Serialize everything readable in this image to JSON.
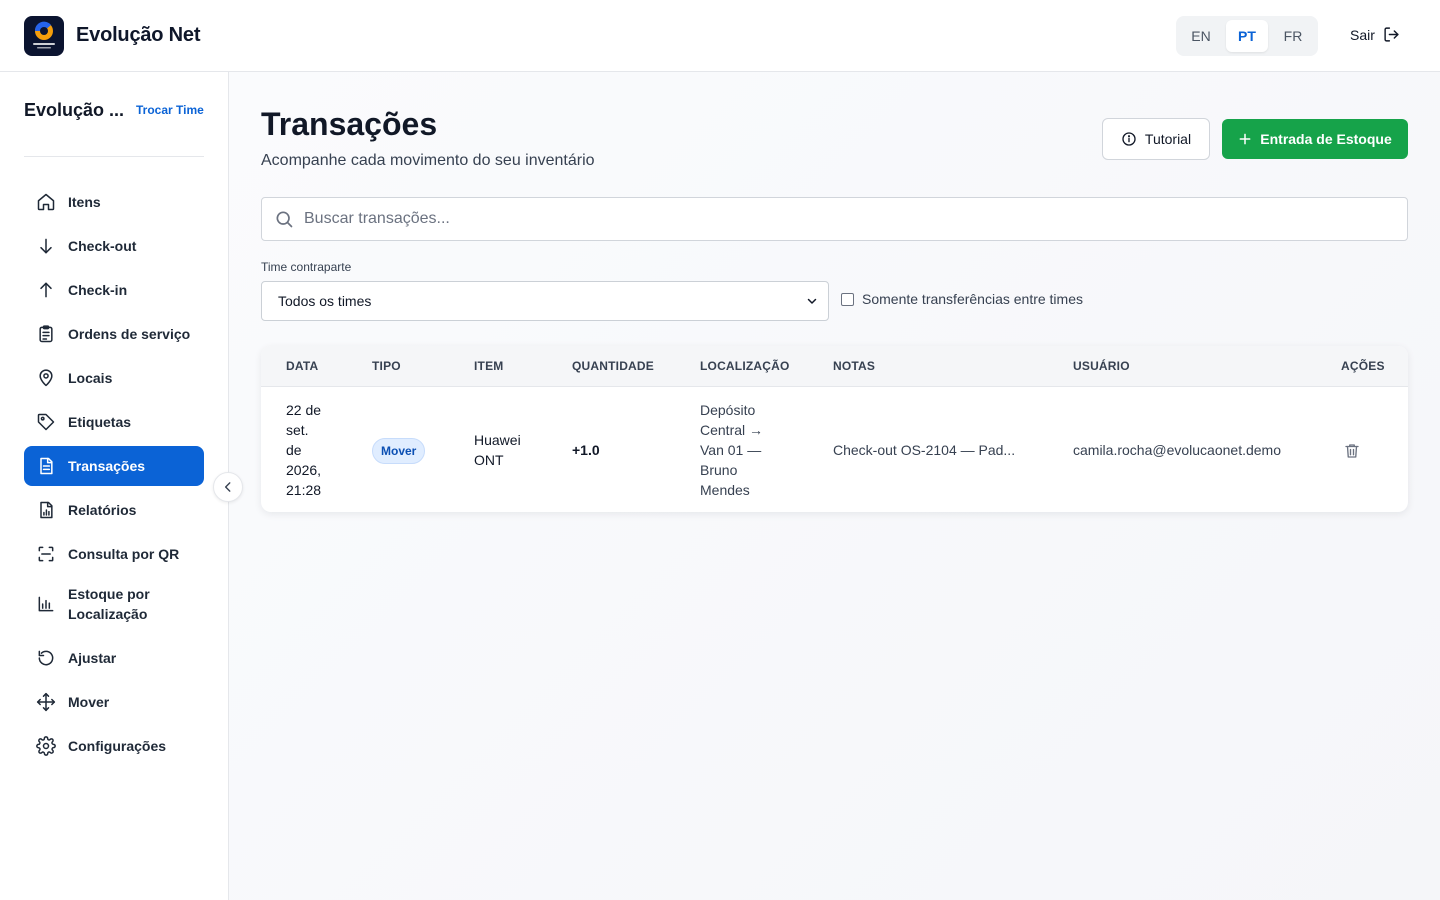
{
  "header": {
    "brand": "Evolução Net",
    "languages": [
      "EN",
      "PT",
      "FR"
    ],
    "active_language": "PT",
    "logout_label": "Sair"
  },
  "sidebar": {
    "team_name": "Evolução ...",
    "switch_team_label": "Trocar Time",
    "items": [
      {
        "label": "Itens",
        "icon": "home-icon"
      },
      {
        "label": "Check-out",
        "icon": "arrow-down-icon"
      },
      {
        "label": "Check-in",
        "icon": "arrow-up-icon"
      },
      {
        "label": "Ordens de serviço",
        "icon": "clipboard-icon"
      },
      {
        "label": "Locais",
        "icon": "map-pin-icon"
      },
      {
        "label": "Etiquetas",
        "icon": "tag-icon"
      },
      {
        "label": "Transações",
        "icon": "document-icon",
        "active": true
      },
      {
        "label": "Relatórios",
        "icon": "report-icon"
      },
      {
        "label": "Consulta por QR",
        "icon": "qr-scan-icon"
      },
      {
        "label": "Estoque por Localização",
        "icon": "bar-chart-icon"
      },
      {
        "label": "Ajustar",
        "icon": "rotate-icon"
      },
      {
        "label": "Mover",
        "icon": "move-icon"
      },
      {
        "label": "Configurações",
        "icon": "gear-icon"
      }
    ]
  },
  "main": {
    "title": "Transações",
    "subtitle": "Acompanhe cada movimento do seu inventário",
    "tutorial_label": "Tutorial",
    "primary_label": "Entrada de Estoque",
    "search_placeholder": "Buscar transações...",
    "filter_label": "Time contraparte",
    "filter_value": "Todos os times",
    "checkbox_label": "Somente transferências entre times",
    "checkbox_checked": false
  },
  "table": {
    "columns": [
      "DATA",
      "TIPO",
      "ITEM",
      "QUANTIDADE",
      "LOCALIZAÇÃO",
      "NOTAS",
      "USUÁRIO",
      "AÇÕES"
    ],
    "rows": [
      {
        "date_lines": [
          "22 de",
          "set.",
          "de",
          "2026,",
          "21:28"
        ],
        "type": "Mover",
        "item_lines": [
          "Huawei",
          "ONT"
        ],
        "quantity": "+1.0",
        "location_lines": [
          "Depósito",
          "Central →",
          "Van 01 —",
          "Bruno",
          "Mendes"
        ],
        "notes": "Check-out OS-2104 — Pad...",
        "user": "camila.rocha@evolucaonet.demo"
      }
    ]
  },
  "colors": {
    "primary": "#0b63d6",
    "success": "#16a34a",
    "badge_bg": "#e0edff"
  }
}
